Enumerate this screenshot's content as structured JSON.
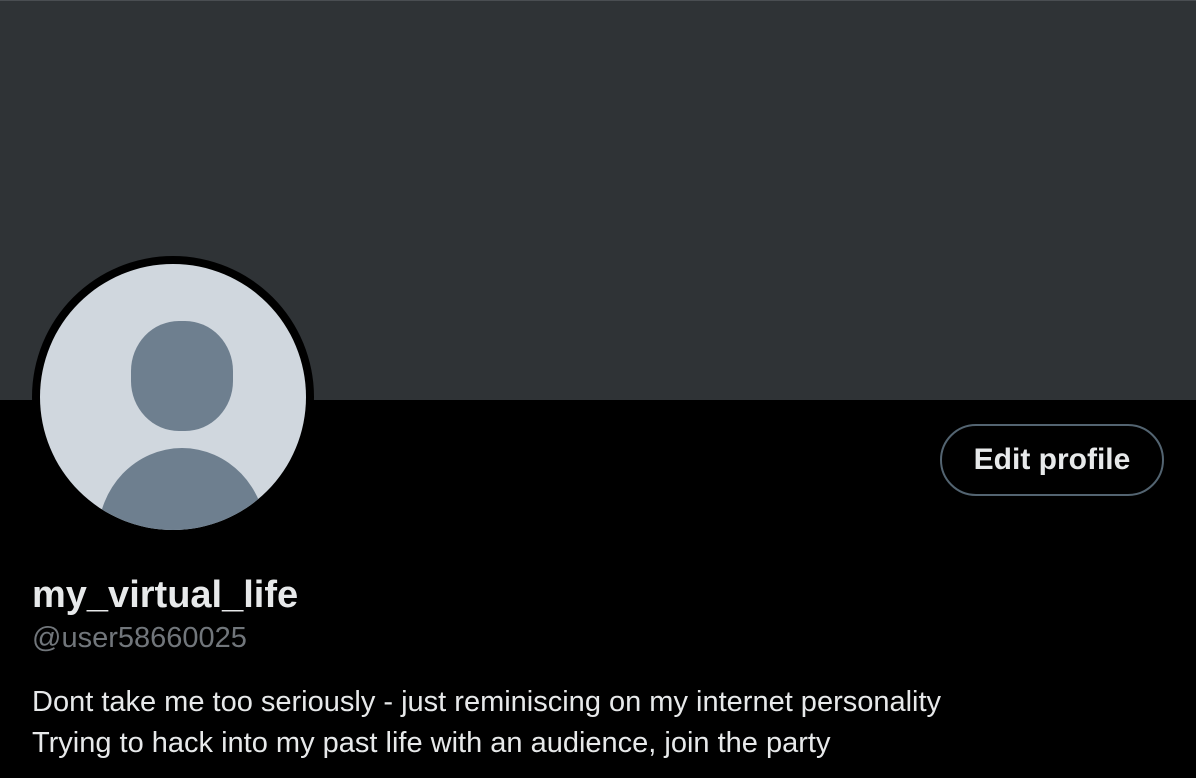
{
  "profile": {
    "display_name": "my_virtual_life",
    "handle": "@user58660025",
    "bio_lines": [
      "Dont take me too seriously - just reminiscing on my internet personality",
      "Trying to hack into my past life with an audience, join the party"
    ],
    "edit_button_label": "Edit profile",
    "avatar_icon": "default-avatar-icon"
  },
  "colors": {
    "banner": "#2f3336",
    "background": "#000000",
    "avatar_bg": "#d0d7de",
    "avatar_figure": "#6e7f8f",
    "primary_text": "#e7e9ea",
    "secondary_text": "#71767b",
    "button_border": "#536471"
  }
}
